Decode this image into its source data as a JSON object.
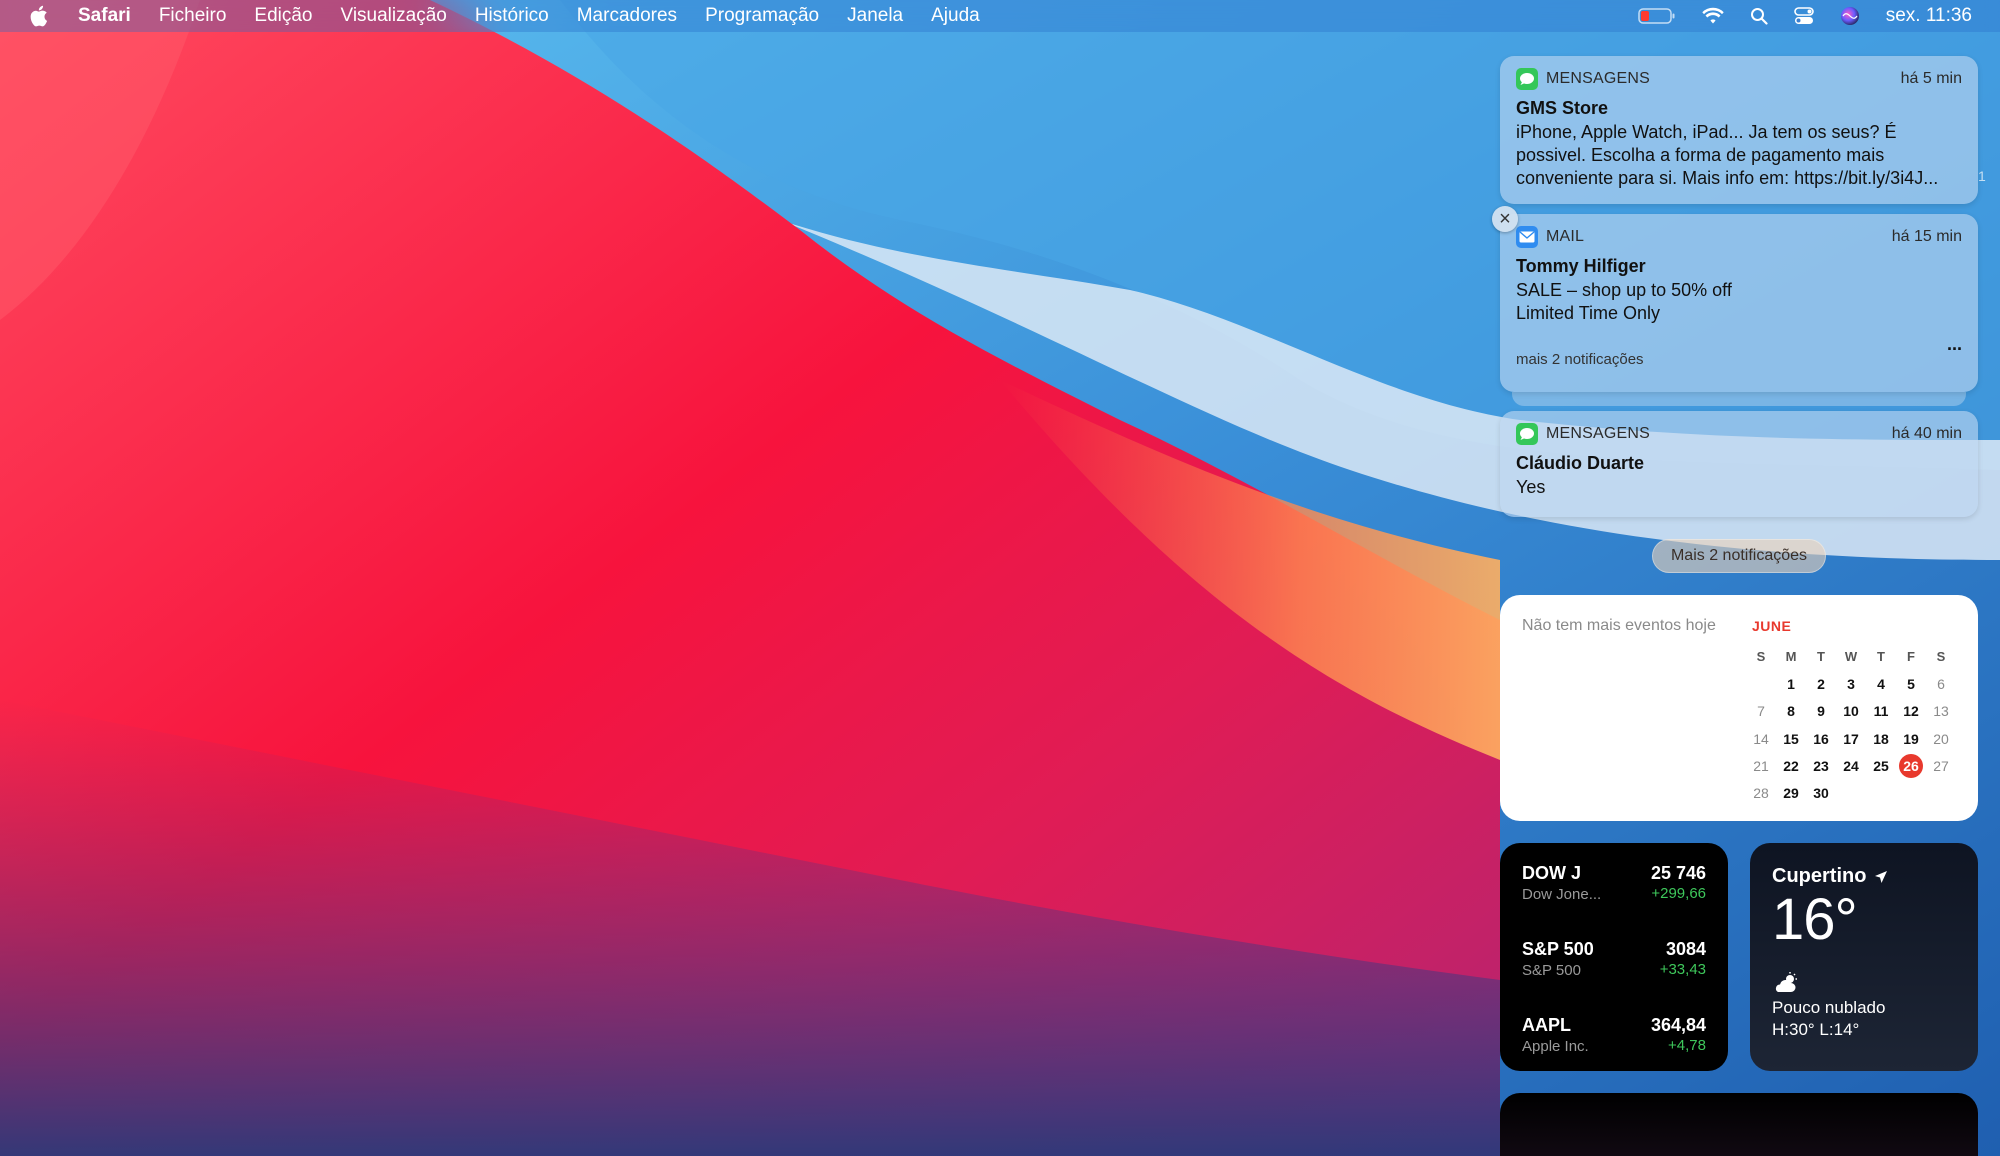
{
  "menubar": {
    "app": "Safari",
    "items": [
      "Ficheiro",
      "Edição",
      "Visualização",
      "Histórico",
      "Marcadores",
      "Programação",
      "Janela",
      "Ajuda"
    ],
    "clock": "sex. 11:36",
    "status_icons": [
      "battery-icon",
      "wifi-icon",
      "search-icon",
      "control-center-icon",
      "siri-icon"
    ]
  },
  "notifications": [
    {
      "app": "MENSAGENS",
      "time": "há 5 min",
      "title": "GMS Store",
      "body": "iPhone, Apple Watch, iPad... Ja tem os seus? É possivel. Escolha a forma de pagamento mais conveniente para si. Mais info em: https://bit.ly/3i4J..."
    },
    {
      "app": "MAIL",
      "time": "há 15 min",
      "title": "Tommy Hilfiger",
      "body_line1": "SALE – shop up to 50% off",
      "body_line2": "Limited Time Only",
      "ellipsis": "...",
      "more": "mais 2 notificações"
    },
    {
      "app": "MENSAGENS",
      "time": "há 40 min",
      "title": "Cláudio Duarte",
      "body": "Yes"
    }
  ],
  "side_badge": "1",
  "more_button": "Mais 2 notificações",
  "close_glyph": "×",
  "calendar": {
    "no_events": "Não tem mais eventos hoje",
    "month": "JUNE",
    "weekdays": [
      "S",
      "M",
      "T",
      "W",
      "T",
      "F",
      "S"
    ],
    "weeks": [
      [
        "",
        "1",
        "2",
        "3",
        "4",
        "5",
        "6"
      ],
      [
        "7",
        "8",
        "9",
        "10",
        "11",
        "12",
        "13"
      ],
      [
        "14",
        "15",
        "16",
        "17",
        "18",
        "19",
        "20"
      ],
      [
        "21",
        "22",
        "23",
        "24",
        "25",
        "26",
        "27"
      ],
      [
        "28",
        "29",
        "30",
        "",
        "",
        "",
        ""
      ]
    ],
    "today": "26",
    "accent": "#e8392d"
  },
  "stocks": [
    {
      "symbol": "DOW J",
      "name": "Dow Jone...",
      "price": "25 746",
      "change": "+299,66"
    },
    {
      "symbol": "S&P 500",
      "name": "S&P 500",
      "price": "3084",
      "change": "+33,43"
    },
    {
      "symbol": "AAPL",
      "name": "Apple Inc.",
      "price": "364,84",
      "change": "+4,78"
    }
  ],
  "weather": {
    "city": "Cupertino",
    "temp": "16°",
    "condition": "Pouco nublado",
    "high_low": "H:30° L:14°"
  }
}
